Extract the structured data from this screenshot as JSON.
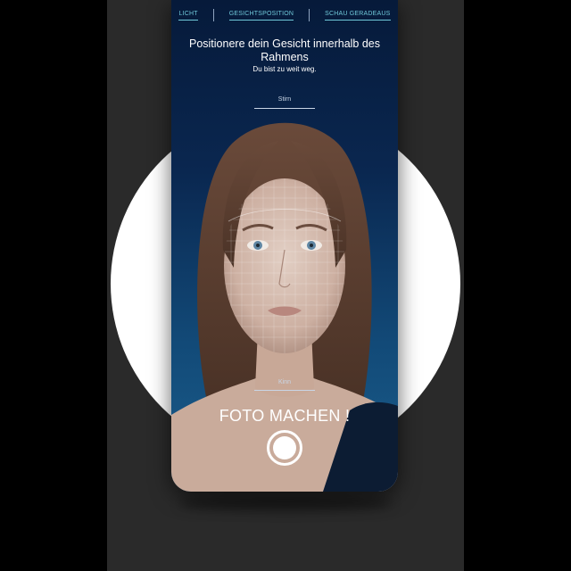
{
  "tabs": [
    {
      "label": "LICHT"
    },
    {
      "label": "GESICHTSPOSITION"
    },
    {
      "label": "SCHAU GERADEAUS"
    }
  ],
  "header": {
    "title": "Positionere dein Gesicht innerhalb des Rahmens",
    "subtitle": "Du bist zu weit weg."
  },
  "guides": {
    "top_label": "Stirn",
    "bottom_label": "Kinn"
  },
  "capture": {
    "label": "FOTO MACHEN !"
  },
  "colors": {
    "accent": "#6fc7d8",
    "background": "#0a2750",
    "text": "#ffffff"
  },
  "icons": {
    "shutter": "shutter-button-icon",
    "face_mesh": "face-mesh-overlay"
  }
}
